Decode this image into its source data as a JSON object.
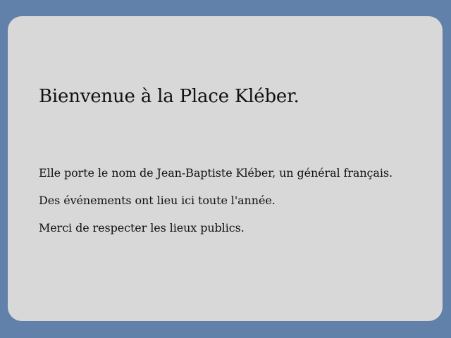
{
  "page": {
    "background_color": "#6180aa",
    "panel_color": "#d8d8d8"
  },
  "content": {
    "title": "Bienvenue à la Place Kléber.",
    "lines": [
      "Elle porte le nom de Jean-Baptiste Kléber, un général français.",
      "Des événements ont lieu ici toute l'année.",
      "Merci de respecter les lieux publics."
    ]
  }
}
